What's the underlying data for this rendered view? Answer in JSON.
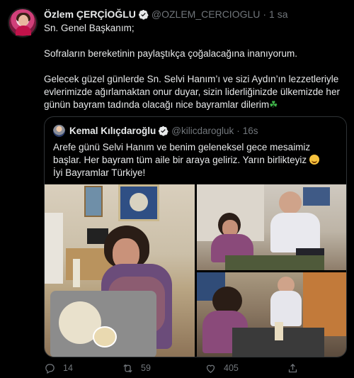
{
  "tweet": {
    "author_name": "Özlem ÇERÇİOĞLU",
    "handle": "@OZLEM_CERCIOGLU",
    "separator": "·",
    "time": "1 sa",
    "paragraphs": [
      "Sn. Genel Başkanım;",
      "Sofraların bereketinin paylaştıkça çoğalacağına inanıyorum.",
      "Gelecek güzel günlerde Sn. Selvi Hanım’ı ve sizi Aydın’ın lezzetleriyle evlerimizde ağırlamaktan onur duyar, sizin liderliğinizde ülkemizde her günün bayram tadında olacağı nice bayramlar dilerim"
    ],
    "clover_emoji": "☘"
  },
  "quote": {
    "author_name": "Kemal Kılıçdaroğlu",
    "handle": "@kilicdarogluk",
    "separator": "·",
    "time": "16s",
    "line1": "Arefe günü Selvi Hanım ve benim geleneksel gece mesaimiz başlar. Her bayram tüm aile bir araya geliriz. Yarın birlikteyiz",
    "line2": "İyi Bayramlar Türkiye!"
  },
  "actions": {
    "reply_count": "14",
    "retweet_count": "59",
    "like_count": "405"
  },
  "icons": {
    "reply": "reply-icon",
    "retweet": "retweet-icon",
    "like": "heart-icon",
    "share": "share-icon",
    "verified": "verified-badge-icon"
  },
  "colors": {
    "background": "#000000",
    "text": "#e7e9ea",
    "muted": "#71767b",
    "verified": "#e7e9ea",
    "border": "#2f3336"
  }
}
